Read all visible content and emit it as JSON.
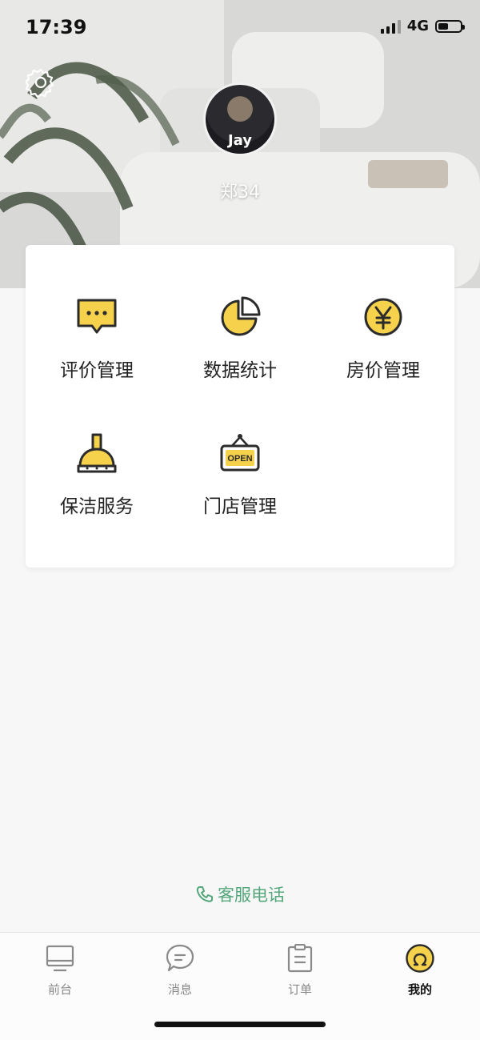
{
  "status": {
    "time": "17:39",
    "network": "4G"
  },
  "profile": {
    "name": "郑34",
    "avatar_text": "Jay"
  },
  "menu": [
    {
      "label": "评价管理",
      "icon": "comment-icon"
    },
    {
      "label": "数据统计",
      "icon": "pie-chart-icon"
    },
    {
      "label": "房价管理",
      "icon": "yuan-icon"
    },
    {
      "label": "保洁服务",
      "icon": "broom-icon"
    },
    {
      "label": "门店管理",
      "icon": "open-sign-icon",
      "sign_text": "OPEN"
    }
  ],
  "service": {
    "label": "客服电话"
  },
  "tabs": [
    {
      "label": "前台",
      "icon": "monitor-icon"
    },
    {
      "label": "消息",
      "icon": "message-icon"
    },
    {
      "label": "订单",
      "icon": "clipboard-icon"
    },
    {
      "label": "我的",
      "icon": "profile-icon",
      "active": true
    }
  ],
  "colors": {
    "accent": "#f5d14c",
    "service_green": "#53a77a",
    "outline": "#2b2b2b"
  }
}
